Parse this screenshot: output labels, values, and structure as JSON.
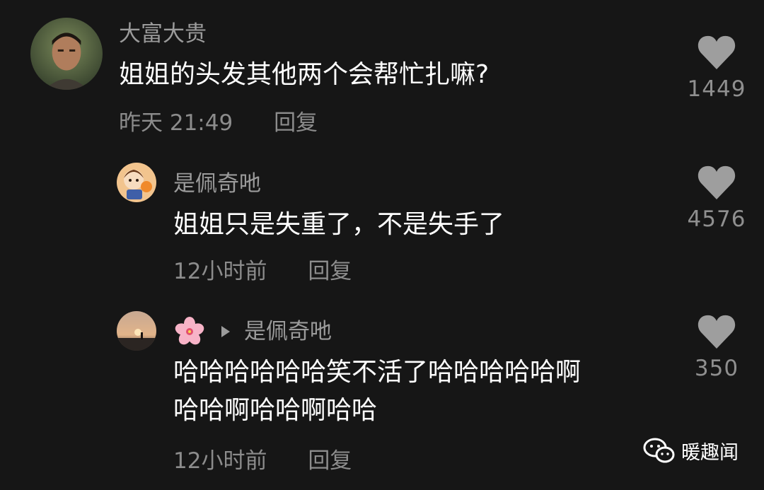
{
  "comments": [
    {
      "username": "大富大贵",
      "content": [
        "姐姐的头发其他两个会帮忙扎嘛?"
      ],
      "time": "昨天 21:49",
      "reply_label": "回复",
      "likes": "1449",
      "avatar": "man-photo-avatar"
    },
    {
      "username": "是佩奇吔",
      "content": [
        "姐姐只是失重了，不是失手了"
      ],
      "time": "12小时前",
      "reply_label": "回复",
      "likes": "4576",
      "avatar": "cartoon-avatar"
    },
    {
      "username_icon": "cherry-blossom-icon",
      "reply_to": "是佩奇吔",
      "content": [
        "哈哈哈哈哈哈笑不活了哈哈哈哈哈啊",
        "哈哈啊哈哈啊哈哈"
      ],
      "time": "12小时前",
      "reply_label": "回复",
      "likes": "350",
      "avatar": "sunset-avatar"
    }
  ],
  "watermark": {
    "icon": "wechat-icon",
    "text": "暖趣闻"
  },
  "colors": {
    "background": "#161616",
    "username": "#9b9b9b",
    "meta": "#8c8c8c",
    "heart": "#9e9e9e"
  }
}
